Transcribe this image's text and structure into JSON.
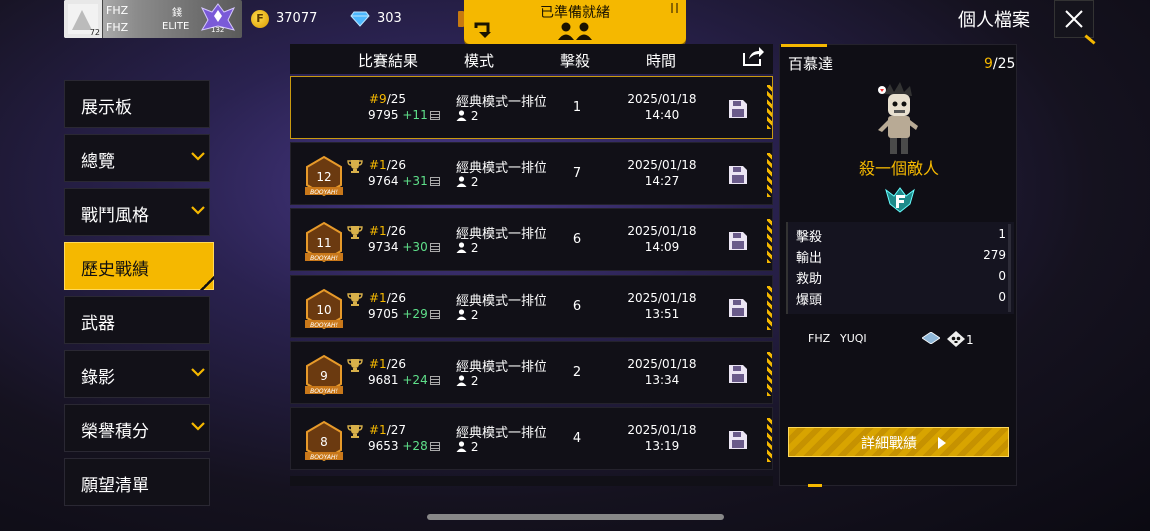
{
  "topbar": {
    "player": {
      "name": "FHZ",
      "tag": "FHZ",
      "title": "錢",
      "title2": "ELITE",
      "level": "72",
      "rank_level": "132"
    },
    "gold_coins": "37077",
    "diamonds": "303",
    "ready_label": "已準備就緒",
    "profile_title": "個人檔案"
  },
  "sidebar": {
    "items": [
      {
        "label": "展示板",
        "has_chevron": false
      },
      {
        "label": "總覽",
        "has_chevron": true
      },
      {
        "label": "戰鬥風格",
        "has_chevron": true
      },
      {
        "label": "歷史戰績",
        "has_chevron": false,
        "active": true
      },
      {
        "label": "武器",
        "has_chevron": false
      },
      {
        "label": "錄影",
        "has_chevron": true
      },
      {
        "label": "榮譽積分",
        "has_chevron": true
      },
      {
        "label": "願望清單",
        "has_chevron": false
      }
    ]
  },
  "table": {
    "headers": {
      "result": "比賽結果",
      "mode": "模式",
      "kills": "擊殺",
      "time": "時間"
    },
    "rows": [
      {
        "badge": "",
        "pos": "#9",
        "total": "/25",
        "score": "9795",
        "plus": "+11",
        "mode": "經典模式一排位",
        "squad": "2",
        "kills": "1",
        "date": "2025/01/18",
        "time": "14:40",
        "selected": true
      },
      {
        "badge": "12",
        "pos": "#1",
        "total": "/26",
        "score": "9764",
        "plus": "+31",
        "mode": "經典模式一排位",
        "squad": "2",
        "kills": "7",
        "date": "2025/01/18",
        "time": "14:27"
      },
      {
        "badge": "11",
        "pos": "#1",
        "total": "/26",
        "score": "9734",
        "plus": "+30",
        "mode": "經典模式一排位",
        "squad": "2",
        "kills": "6",
        "date": "2025/01/18",
        "time": "14:09"
      },
      {
        "badge": "10",
        "pos": "#1",
        "total": "/26",
        "score": "9705",
        "plus": "+29",
        "mode": "經典模式一排位",
        "squad": "2",
        "kills": "6",
        "date": "2025/01/18",
        "time": "13:51"
      },
      {
        "badge": "9",
        "pos": "#1",
        "total": "/26",
        "score": "9681",
        "plus": "+24",
        "mode": "經典模式一排位",
        "squad": "2",
        "kills": "2",
        "date": "2025/01/18",
        "time": "13:34"
      },
      {
        "badge": "8",
        "pos": "#1",
        "total": "/27",
        "score": "9653",
        "plus": "+28",
        "mode": "經典模式一排位",
        "squad": "2",
        "kills": "4",
        "date": "2025/01/18",
        "time": "13:19"
      }
    ]
  },
  "detail": {
    "name": "百慕達",
    "rank_pos": "9",
    "rank_total": "/25",
    "kill_title": "殺一個敵人",
    "stats": [
      {
        "label": "擊殺",
        "value": "1"
      },
      {
        "label": "輸出",
        "value": "279"
      },
      {
        "label": "救助",
        "value": "0"
      },
      {
        "label": "爆頭",
        "value": "0"
      }
    ],
    "teammates": [
      "FHZ",
      "YUQI"
    ],
    "team_kills": "1",
    "detail_button": "詳細戰績"
  },
  "colors": {
    "accent": "#f5b800",
    "positive": "#5fe08a",
    "panel": "#111017"
  }
}
